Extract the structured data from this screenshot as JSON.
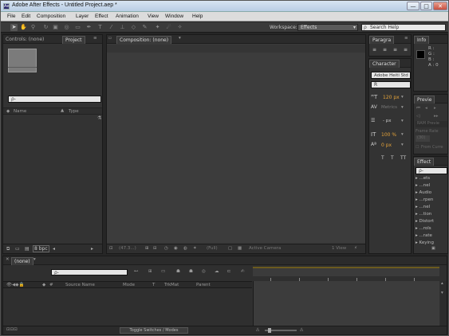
{
  "window": {
    "title": "Adobe After Effects - Untitled Project.aep *",
    "minimize": "—",
    "maximize": "□",
    "close": "✕"
  },
  "menu": [
    "File",
    "Edit",
    "Composition",
    "Layer",
    "Effect",
    "Animation",
    "View",
    "Window",
    "Help"
  ],
  "toolbar": {
    "workspace_label": "Workspace:",
    "workspace_value": "Effects",
    "search_placeholder": "Search Help"
  },
  "project": {
    "tab_controls": "Controls: (none)",
    "tab_project": "Project",
    "search_placeholder": "ρ-",
    "col_name": "Name",
    "col_type": "Type",
    "bpc": "8 bpc"
  },
  "composition": {
    "tab": "Composition: (none)",
    "zoom": "(47.3...)",
    "res": "(Full)",
    "view": "1 View",
    "active_camera": "Active Camera"
  },
  "paragraph": {
    "tab": "Paragra"
  },
  "info": {
    "tab": "Info",
    "r": "R :",
    "g": "G :",
    "b": "B :",
    "a": "A : 0"
  },
  "character": {
    "tab": "Character",
    "font": "Adobe Heiti Std",
    "style": "R",
    "size": "120 px",
    "leading": "Auto",
    "kerning": "Metrics",
    "tracking": "0",
    "stroke": "- px",
    "vscale": "100 %",
    "baseline": "0 px",
    "tsume": "0 %"
  },
  "preview": {
    "tab": "Previe",
    "ram": "RAM Previe",
    "frame_rate": "Frame Rate",
    "rate_val": "(30)",
    "from_current": "From Curre"
  },
  "effects": {
    "tab": "Effect",
    "search_placeholder": "ρ-",
    "items": [
      "...ets",
      "...nel",
      "Audio",
      "...rpen",
      "...nel",
      "...tion",
      "Distort",
      "...rols",
      "...rate",
      "Keying"
    ]
  },
  "timeline": {
    "tab": "(none)",
    "search_placeholder": "ρ-",
    "col_source": "Source Name",
    "col_mode": "Mode",
    "col_t": "T",
    "col_trkmat": "TrkMat",
    "col_parent": "Parent",
    "toggle": "Toggle Switches / Modes"
  }
}
